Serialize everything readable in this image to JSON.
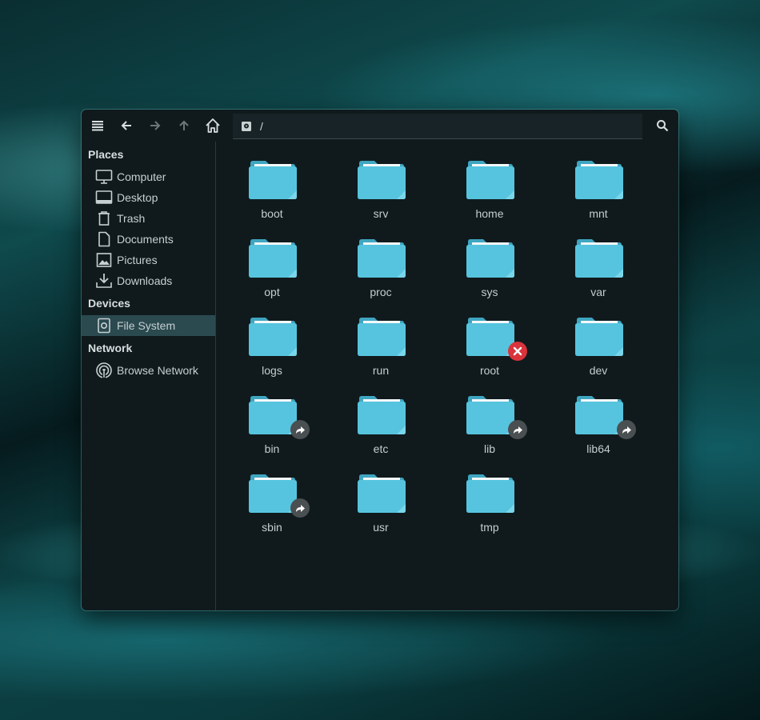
{
  "toolbar": {
    "icons": [
      "menu-icon",
      "back-arrow-icon",
      "forward-arrow-icon",
      "up-arrow-icon",
      "home-icon",
      "search-icon"
    ],
    "path": "/"
  },
  "sidebar": {
    "places_title": "Places",
    "places": [
      {
        "label": "Computer",
        "icon": "monitor-icon"
      },
      {
        "label": "Desktop",
        "icon": "desktop-icon"
      },
      {
        "label": "Trash",
        "icon": "trash-icon"
      },
      {
        "label": "Documents",
        "icon": "document-icon"
      },
      {
        "label": "Pictures",
        "icon": "picture-icon"
      },
      {
        "label": "Downloads",
        "icon": "download-icon"
      }
    ],
    "devices_title": "Devices",
    "devices": [
      {
        "label": "File System",
        "icon": "drive-icon",
        "selected": true
      }
    ],
    "network_title": "Network",
    "network": [
      {
        "label": "Browse Network",
        "icon": "network-icon"
      }
    ]
  },
  "files": [
    {
      "name": "boot",
      "emblem": ""
    },
    {
      "name": "srv",
      "emblem": ""
    },
    {
      "name": "home",
      "emblem": ""
    },
    {
      "name": "mnt",
      "emblem": ""
    },
    {
      "name": "opt",
      "emblem": ""
    },
    {
      "name": "proc",
      "emblem": ""
    },
    {
      "name": "sys",
      "emblem": ""
    },
    {
      "name": "var",
      "emblem": ""
    },
    {
      "name": "logs",
      "emblem": ""
    },
    {
      "name": "run",
      "emblem": ""
    },
    {
      "name": "root",
      "emblem": "locked"
    },
    {
      "name": "dev",
      "emblem": ""
    },
    {
      "name": "bin",
      "emblem": "link"
    },
    {
      "name": "etc",
      "emblem": ""
    },
    {
      "name": "lib",
      "emblem": "link"
    },
    {
      "name": "lib64",
      "emblem": "link"
    },
    {
      "name": "sbin",
      "emblem": "link"
    },
    {
      "name": "usr",
      "emblem": ""
    },
    {
      "name": "tmp",
      "emblem": ""
    }
  ],
  "colors": {
    "folder": "#56c4de",
    "folder_dark": "#3fa6c1",
    "selection": "#2b4a50",
    "locked_emblem": "#d9333b"
  }
}
